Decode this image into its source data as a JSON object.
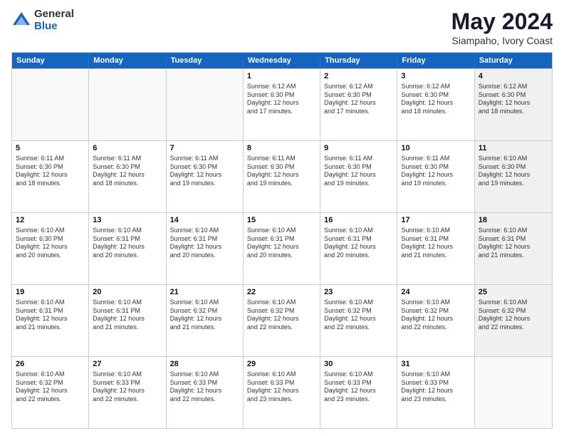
{
  "logo": {
    "general": "General",
    "blue": "Blue"
  },
  "title": "May 2024",
  "subtitle": "Siampaho, Ivory Coast",
  "header_days": [
    "Sunday",
    "Monday",
    "Tuesday",
    "Wednesday",
    "Thursday",
    "Friday",
    "Saturday"
  ],
  "weeks": [
    [
      {
        "day": "",
        "lines": [],
        "empty": true
      },
      {
        "day": "",
        "lines": [],
        "empty": true
      },
      {
        "day": "",
        "lines": [],
        "empty": true
      },
      {
        "day": "1",
        "lines": [
          "Sunrise: 6:12 AM",
          "Sunset: 6:30 PM",
          "Daylight: 12 hours",
          "and 17 minutes."
        ],
        "empty": false
      },
      {
        "day": "2",
        "lines": [
          "Sunrise: 6:12 AM",
          "Sunset: 6:30 PM",
          "Daylight: 12 hours",
          "and 17 minutes."
        ],
        "empty": false
      },
      {
        "day": "3",
        "lines": [
          "Sunrise: 6:12 AM",
          "Sunset: 6:30 PM",
          "Daylight: 12 hours",
          "and 18 minutes."
        ],
        "empty": false
      },
      {
        "day": "4",
        "lines": [
          "Sunrise: 6:12 AM",
          "Sunset: 6:30 PM",
          "Daylight: 12 hours",
          "and 18 minutes."
        ],
        "empty": false,
        "shaded": true
      }
    ],
    [
      {
        "day": "5",
        "lines": [
          "Sunrise: 6:11 AM",
          "Sunset: 6:30 PM",
          "Daylight: 12 hours",
          "and 18 minutes."
        ],
        "empty": false
      },
      {
        "day": "6",
        "lines": [
          "Sunrise: 6:11 AM",
          "Sunset: 6:30 PM",
          "Daylight: 12 hours",
          "and 18 minutes."
        ],
        "empty": false
      },
      {
        "day": "7",
        "lines": [
          "Sunrise: 6:11 AM",
          "Sunset: 6:30 PM",
          "Daylight: 12 hours",
          "and 19 minutes."
        ],
        "empty": false
      },
      {
        "day": "8",
        "lines": [
          "Sunrise: 6:11 AM",
          "Sunset: 6:30 PM",
          "Daylight: 12 hours",
          "and 19 minutes."
        ],
        "empty": false
      },
      {
        "day": "9",
        "lines": [
          "Sunrise: 6:11 AM",
          "Sunset: 6:30 PM",
          "Daylight: 12 hours",
          "and 19 minutes."
        ],
        "empty": false
      },
      {
        "day": "10",
        "lines": [
          "Sunrise: 6:11 AM",
          "Sunset: 6:30 PM",
          "Daylight: 12 hours",
          "and 19 minutes."
        ],
        "empty": false
      },
      {
        "day": "11",
        "lines": [
          "Sunrise: 6:10 AM",
          "Sunset: 6:30 PM",
          "Daylight: 12 hours",
          "and 19 minutes."
        ],
        "empty": false,
        "shaded": true
      }
    ],
    [
      {
        "day": "12",
        "lines": [
          "Sunrise: 6:10 AM",
          "Sunset: 6:30 PM",
          "Daylight: 12 hours",
          "and 20 minutes."
        ],
        "empty": false
      },
      {
        "day": "13",
        "lines": [
          "Sunrise: 6:10 AM",
          "Sunset: 6:31 PM",
          "Daylight: 12 hours",
          "and 20 minutes."
        ],
        "empty": false
      },
      {
        "day": "14",
        "lines": [
          "Sunrise: 6:10 AM",
          "Sunset: 6:31 PM",
          "Daylight: 12 hours",
          "and 20 minutes."
        ],
        "empty": false
      },
      {
        "day": "15",
        "lines": [
          "Sunrise: 6:10 AM",
          "Sunset: 6:31 PM",
          "Daylight: 12 hours",
          "and 20 minutes."
        ],
        "empty": false
      },
      {
        "day": "16",
        "lines": [
          "Sunrise: 6:10 AM",
          "Sunset: 6:31 PM",
          "Daylight: 12 hours",
          "and 20 minutes."
        ],
        "empty": false
      },
      {
        "day": "17",
        "lines": [
          "Sunrise: 6:10 AM",
          "Sunset: 6:31 PM",
          "Daylight: 12 hours",
          "and 21 minutes."
        ],
        "empty": false
      },
      {
        "day": "18",
        "lines": [
          "Sunrise: 6:10 AM",
          "Sunset: 6:31 PM",
          "Daylight: 12 hours",
          "and 21 minutes."
        ],
        "empty": false,
        "shaded": true
      }
    ],
    [
      {
        "day": "19",
        "lines": [
          "Sunrise: 6:10 AM",
          "Sunset: 6:31 PM",
          "Daylight: 12 hours",
          "and 21 minutes."
        ],
        "empty": false
      },
      {
        "day": "20",
        "lines": [
          "Sunrise: 6:10 AM",
          "Sunset: 6:31 PM",
          "Daylight: 12 hours",
          "and 21 minutes."
        ],
        "empty": false
      },
      {
        "day": "21",
        "lines": [
          "Sunrise: 6:10 AM",
          "Sunset: 6:32 PM",
          "Daylight: 12 hours",
          "and 21 minutes."
        ],
        "empty": false
      },
      {
        "day": "22",
        "lines": [
          "Sunrise: 6:10 AM",
          "Sunset: 6:32 PM",
          "Daylight: 12 hours",
          "and 22 minutes."
        ],
        "empty": false
      },
      {
        "day": "23",
        "lines": [
          "Sunrise: 6:10 AM",
          "Sunset: 6:32 PM",
          "Daylight: 12 hours",
          "and 22 minutes."
        ],
        "empty": false
      },
      {
        "day": "24",
        "lines": [
          "Sunrise: 6:10 AM",
          "Sunset: 6:32 PM",
          "Daylight: 12 hours",
          "and 22 minutes."
        ],
        "empty": false
      },
      {
        "day": "25",
        "lines": [
          "Sunrise: 6:10 AM",
          "Sunset: 6:32 PM",
          "Daylight: 12 hours",
          "and 22 minutes."
        ],
        "empty": false,
        "shaded": true
      }
    ],
    [
      {
        "day": "26",
        "lines": [
          "Sunrise: 6:10 AM",
          "Sunset: 6:32 PM",
          "Daylight: 12 hours",
          "and 22 minutes."
        ],
        "empty": false
      },
      {
        "day": "27",
        "lines": [
          "Sunrise: 6:10 AM",
          "Sunset: 6:33 PM",
          "Daylight: 12 hours",
          "and 22 minutes."
        ],
        "empty": false
      },
      {
        "day": "28",
        "lines": [
          "Sunrise: 6:10 AM",
          "Sunset: 6:33 PM",
          "Daylight: 12 hours",
          "and 22 minutes."
        ],
        "empty": false
      },
      {
        "day": "29",
        "lines": [
          "Sunrise: 6:10 AM",
          "Sunset: 6:33 PM",
          "Daylight: 12 hours",
          "and 23 minutes."
        ],
        "empty": false
      },
      {
        "day": "30",
        "lines": [
          "Sunrise: 6:10 AM",
          "Sunset: 6:33 PM",
          "Daylight: 12 hours",
          "and 23 minutes."
        ],
        "empty": false
      },
      {
        "day": "31",
        "lines": [
          "Sunrise: 6:10 AM",
          "Sunset: 6:33 PM",
          "Daylight: 12 hours",
          "and 23 minutes."
        ],
        "empty": false
      },
      {
        "day": "",
        "lines": [],
        "empty": true,
        "shaded": true
      }
    ]
  ]
}
